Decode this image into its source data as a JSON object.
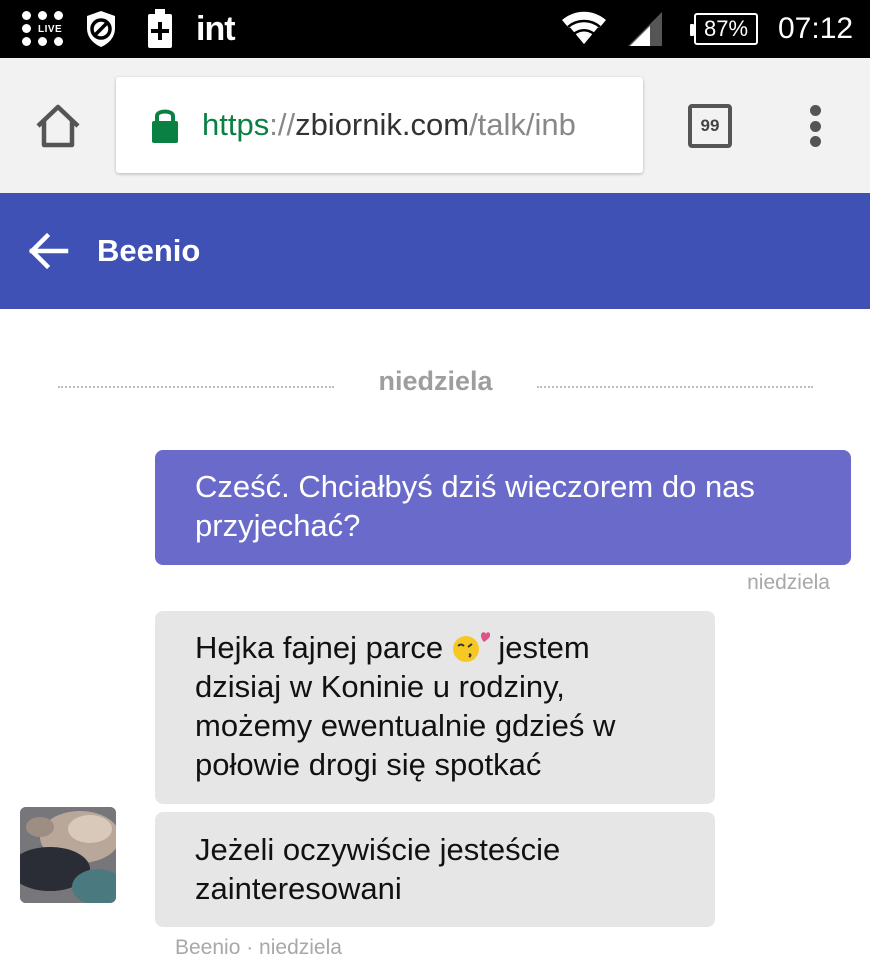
{
  "status_bar": {
    "app_label": "int",
    "battery": "87%",
    "time": "07:12",
    "live_text": "LIVE"
  },
  "browser": {
    "url_scheme": "https",
    "url_separator": "://",
    "url_domain": "zbiornik.com",
    "url_path": "/talk/inb",
    "tabs_count": "99",
    "secure_color": "#0b8043"
  },
  "header": {
    "contact_name": "Beenio",
    "color": "#3f51b5"
  },
  "chat": {
    "date_divider": "niedziela",
    "messages": [
      {
        "direction": "outgoing",
        "text": "Cześć. Chciałbyś dziś wieczorem do nas przyjechać?",
        "meta": "niedziela"
      },
      {
        "direction": "incoming",
        "text_before_emoji": "Hejka fajnej parce",
        "emoji": "kissing-face-with-heart-icon",
        "text_after_emoji": "jestem dzisiaj w Koninie u rodziny, możemy ewentualnie gdzieś w połowie drogi się spotkać"
      },
      {
        "direction": "incoming",
        "text": "Jeżeli oczywiście jesteście zainteresowani"
      }
    ],
    "incoming_meta": "Beenio · niedziela",
    "outgoing_color": "#6a6acb",
    "incoming_color": "#e6e6e6"
  }
}
